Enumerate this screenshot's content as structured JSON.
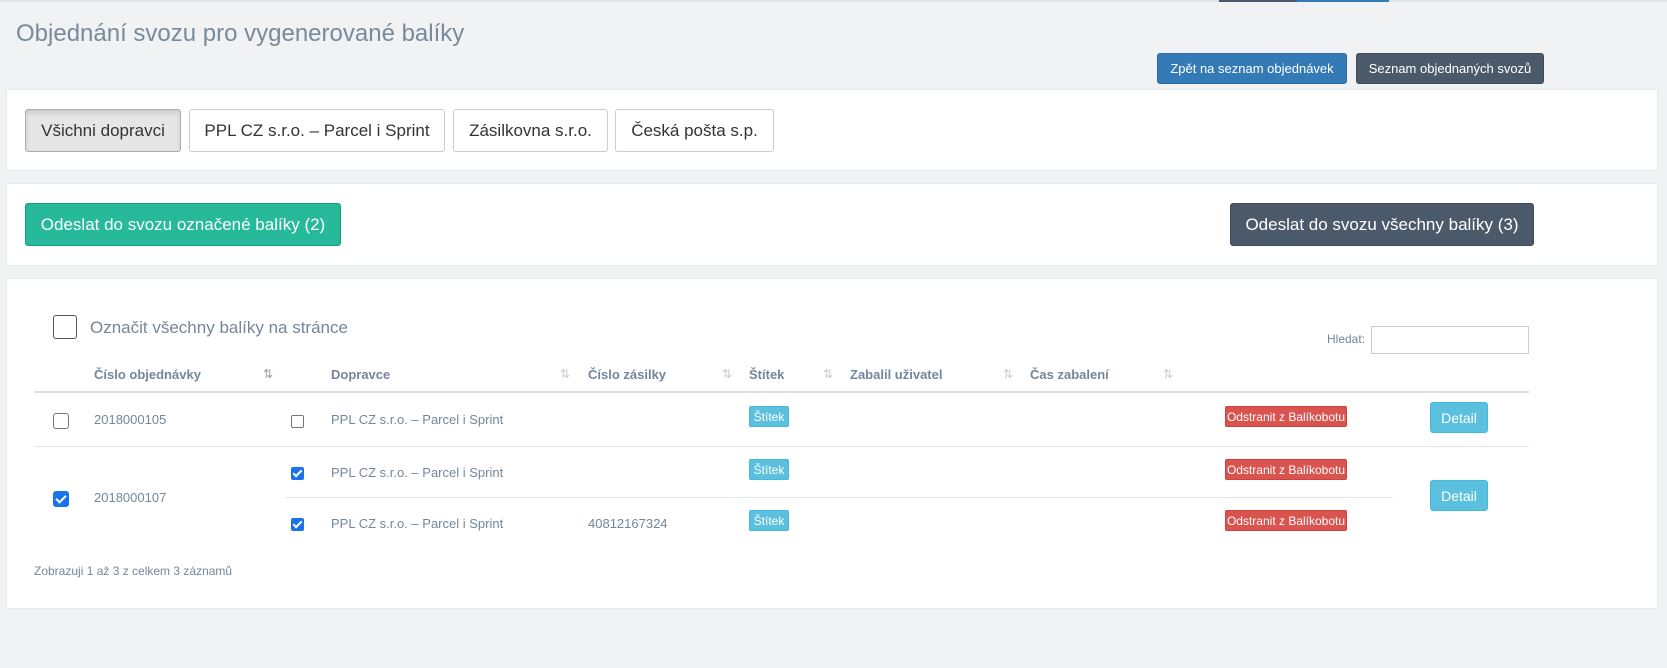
{
  "page": {
    "title": "Objednání svozu pro vygenerované balíky"
  },
  "header_buttons": {
    "back": "Zpět na seznam objednávek",
    "pickups": "Seznam objednaných svozů"
  },
  "carrier_filters": [
    {
      "label": "Všichni dopravci",
      "active": true
    },
    {
      "label": "PPL CZ s.r.o. – Parcel i Sprint",
      "active": false
    },
    {
      "label": "Zásilkovna s.r.o.",
      "active": false
    },
    {
      "label": "Česká pošta s.p.",
      "active": false
    }
  ],
  "actions": {
    "send_selected": "Odeslat do svozu označené balíky (2)",
    "send_all": "Odeslat do svozu všechny balíky (3)"
  },
  "table_controls": {
    "select_all_label": "Označit všechny balíky na stránce",
    "search_label": "Hledat:",
    "search_value": ""
  },
  "table": {
    "columns": [
      "Číslo objednávky",
      "Dopravce",
      "Číslo zásilky",
      "Štítek",
      "Zabalil uživatel",
      "Čas zabalení"
    ],
    "orders": [
      {
        "order_number": "2018000105",
        "checked": false,
        "detail_label": "Detail",
        "packages": [
          {
            "checked": false,
            "carrier": "PPL CZ s.r.o. – Parcel i Sprint",
            "tracking": "",
            "label_btn": "Štítek",
            "packed_by": "",
            "packed_at": "",
            "remove_label": "Odstranit z Balíkobotu"
          }
        ]
      },
      {
        "order_number": "2018000107",
        "checked": true,
        "detail_label": "Detail",
        "packages": [
          {
            "checked": true,
            "carrier": "PPL CZ s.r.o. – Parcel i Sprint",
            "tracking": "",
            "label_btn": "Štítek",
            "packed_by": "",
            "packed_at": "",
            "remove_label": "Odstranit z Balíkobotu"
          },
          {
            "checked": true,
            "carrier": "PPL CZ s.r.o. – Parcel i Sprint",
            "tracking": "40812167324",
            "label_btn": "Štítek",
            "packed_by": "",
            "packed_at": "",
            "remove_label": "Odstranit z Balíkobotu"
          }
        ]
      }
    ]
  },
  "footer": {
    "info": "Zobrazuji 1 až 3 z celkem 3 záznamů"
  },
  "colors": {
    "primary": "#337ab7",
    "dark": "#4b5a6a",
    "success": "#26b99a",
    "info": "#5bc0de",
    "danger": "#d9534f"
  }
}
